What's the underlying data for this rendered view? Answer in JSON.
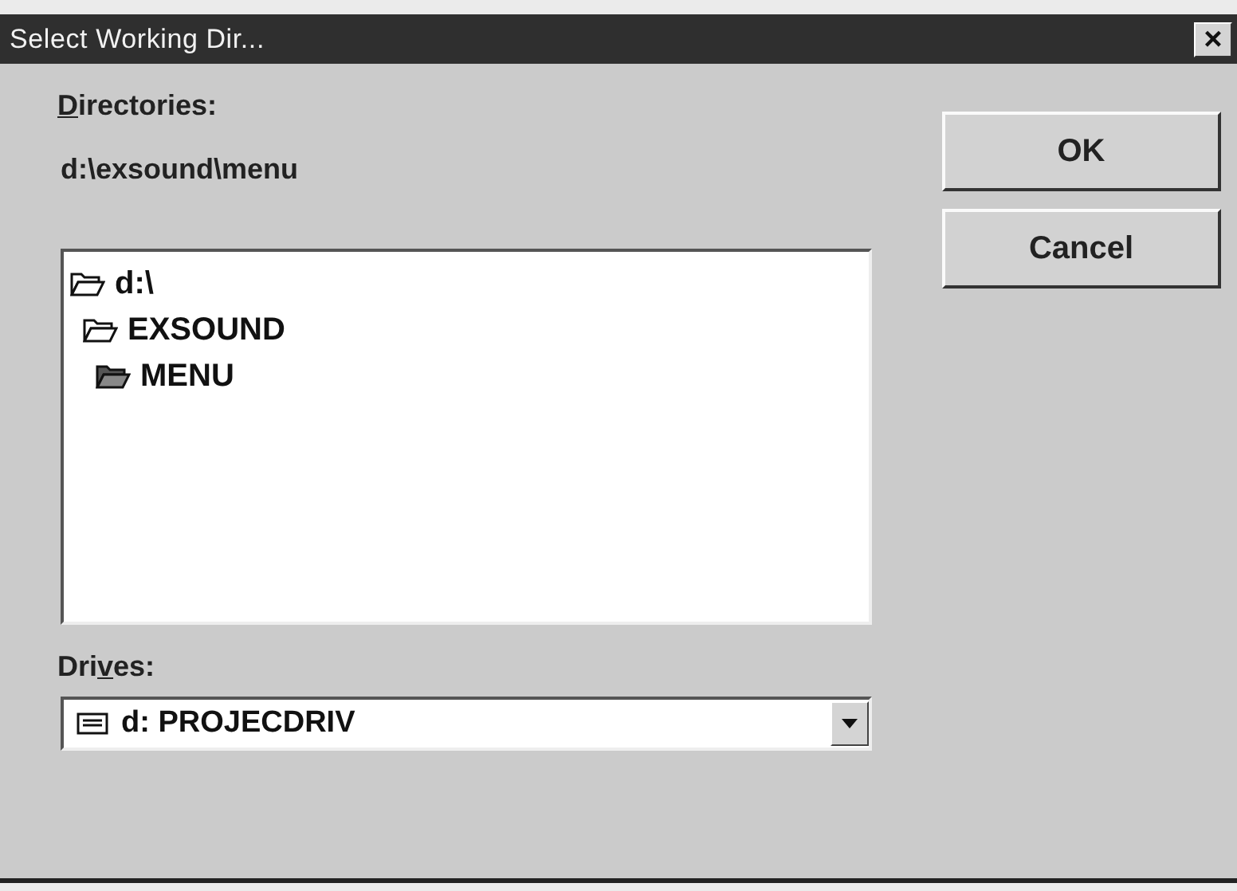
{
  "window": {
    "title": "Select Working Dir...",
    "close": "×"
  },
  "directories": {
    "label": {
      "key": "D",
      "after": "irectories:"
    },
    "path": "d:\\exsound\\menu",
    "tree": [
      {
        "name": "d:\\",
        "selected": false,
        "children": [
          {
            "name": "EXSOUND",
            "selected": false,
            "children": [
              {
                "name": "MENU",
                "selected": true
              }
            ]
          }
        ]
      }
    ]
  },
  "drives": {
    "label": {
      "before": "Dri",
      "key": "v",
      "after": "es:"
    },
    "value": "d: PROJECDRIV"
  },
  "buttons": [
    "OK",
    "Cancel"
  ]
}
